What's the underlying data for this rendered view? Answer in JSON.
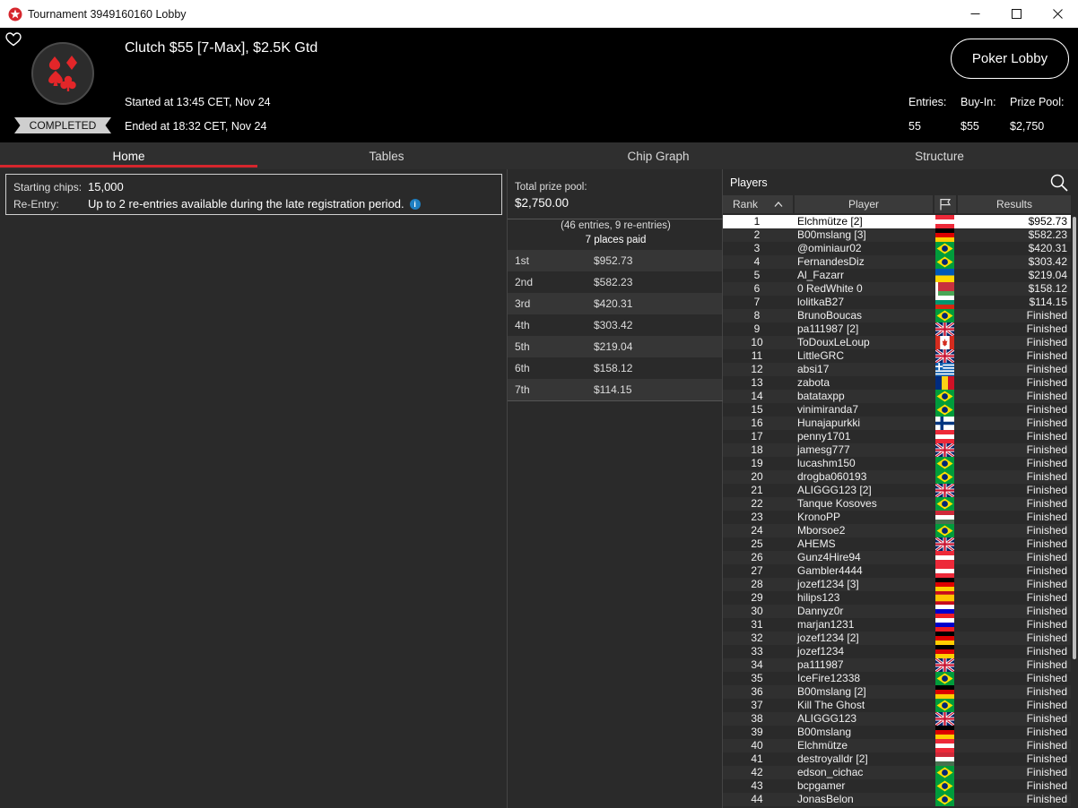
{
  "window": {
    "title": "Tournament 3949160160 Lobby",
    "controls": {
      "minimize": "minimize",
      "maximize": "maximize",
      "close": "close"
    }
  },
  "header": {
    "tournament_name": "Clutch $55 [7-Max], $2.5K Gtd",
    "started": "Started at 13:45 CET, Nov 24",
    "ended": "Ended at 18:32 CET, Nov 24",
    "status": "COMPLETED",
    "poker_lobby_label": "Poker Lobby",
    "entries_label": "Entries:",
    "entries_value": "55",
    "buyin_label": "Buy-In:",
    "buyin_value": "$55",
    "prizepool_label": "Prize Pool:",
    "prizepool_value": "$2,750",
    "icons": {
      "favorite": "heart-icon",
      "logo": "card-suits-logo"
    }
  },
  "tabs": [
    "Home",
    "Tables",
    "Chip Graph",
    "Structure"
  ],
  "active_tab": "Home",
  "home": {
    "starting_chips_label": "Starting chips:",
    "starting_chips_value": "15,000",
    "reentry_label": "Re-Entry:",
    "reentry_value": "Up to 2 re-entries available during the late registration period."
  },
  "prizes": {
    "total_label": "Total prize pool:",
    "total_value": "$2,750.00",
    "entries_note": "(46 entries, 9 re-entries)",
    "places_paid": "7 places paid",
    "payouts": [
      {
        "place": "1st",
        "amount": "$952.73"
      },
      {
        "place": "2nd",
        "amount": "$582.23"
      },
      {
        "place": "3rd",
        "amount": "$420.31"
      },
      {
        "place": "4th",
        "amount": "$303.42"
      },
      {
        "place": "5th",
        "amount": "$219.04"
      },
      {
        "place": "6th",
        "amount": "$158.12"
      },
      {
        "place": "7th",
        "amount": "$114.15"
      }
    ]
  },
  "players": {
    "title": "Players",
    "columns": {
      "rank": "Rank",
      "player": "Player",
      "results": "Results"
    },
    "colors": {
      "accent_red": "#d6262d",
      "row_alt": "#303030",
      "selected_row": "#ffffff"
    },
    "rows": [
      {
        "rank": "1",
        "name": "Elchmütze [2]",
        "flag": "austria",
        "result": "$952.73"
      },
      {
        "rank": "2",
        "name": "B00mslang [3]",
        "flag": "germany",
        "result": "$582.23"
      },
      {
        "rank": "3",
        "name": "@ominiaur02",
        "flag": "brazil",
        "result": "$420.31"
      },
      {
        "rank": "4",
        "name": "FernandesDiz",
        "flag": "brazil",
        "result": "$303.42"
      },
      {
        "rank": "5",
        "name": "Al_Fazarr",
        "flag": "ukraine",
        "result": "$219.04"
      },
      {
        "rank": "6",
        "name": "0 RedWhite 0",
        "flag": "belarus",
        "result": "$158.12"
      },
      {
        "rank": "7",
        "name": "lolitkaB27",
        "flag": "bulgaria",
        "result": "$114.15"
      },
      {
        "rank": "8",
        "name": "BrunoBoucas",
        "flag": "brazil",
        "result": "Finished"
      },
      {
        "rank": "9",
        "name": "pa111987 [2]",
        "flag": "uk",
        "result": "Finished"
      },
      {
        "rank": "10",
        "name": "ToDouxLeLoup",
        "flag": "canada",
        "result": "Finished"
      },
      {
        "rank": "11",
        "name": "LittleGRC",
        "flag": "uk",
        "result": "Finished"
      },
      {
        "rank": "12",
        "name": "absi17",
        "flag": "greece",
        "result": "Finished"
      },
      {
        "rank": "13",
        "name": "zabota",
        "flag": "romania",
        "result": "Finished"
      },
      {
        "rank": "14",
        "name": "batataxpp",
        "flag": "brazil",
        "result": "Finished"
      },
      {
        "rank": "15",
        "name": "vinimiranda7",
        "flag": "brazil",
        "result": "Finished"
      },
      {
        "rank": "16",
        "name": "Hunajapurkki",
        "flag": "finland",
        "result": "Finished"
      },
      {
        "rank": "17",
        "name": "penny1701",
        "flag": "austria",
        "result": "Finished"
      },
      {
        "rank": "18",
        "name": "jamesg777",
        "flag": "uk",
        "result": "Finished"
      },
      {
        "rank": "19",
        "name": "lucashm150",
        "flag": "brazil",
        "result": "Finished"
      },
      {
        "rank": "20",
        "name": "drogba060193",
        "flag": "brazil",
        "result": "Finished"
      },
      {
        "rank": "21",
        "name": "ALIGGG123 [2]",
        "flag": "uk",
        "result": "Finished"
      },
      {
        "rank": "22",
        "name": "Tanque Kosoves",
        "flag": "brazil",
        "result": "Finished"
      },
      {
        "rank": "23",
        "name": "KronoPP",
        "flag": "hungary",
        "result": "Finished"
      },
      {
        "rank": "24",
        "name": "Mborsoe2",
        "flag": "brazil",
        "result": "Finished"
      },
      {
        "rank": "25",
        "name": "AHEMS",
        "flag": "uk",
        "result": "Finished"
      },
      {
        "rank": "26",
        "name": "Gunz4Hire94",
        "flag": "austria",
        "result": "Finished"
      },
      {
        "rank": "27",
        "name": "Gambler4444",
        "flag": "austria",
        "result": "Finished"
      },
      {
        "rank": "28",
        "name": "jozef1234 [3]",
        "flag": "germany",
        "result": "Finished"
      },
      {
        "rank": "29",
        "name": "hilips123",
        "flag": "spain",
        "result": "Finished"
      },
      {
        "rank": "30",
        "name": "Dannyz0r",
        "flag": "slovenia",
        "result": "Finished"
      },
      {
        "rank": "31",
        "name": "marjan1231",
        "flag": "slovenia",
        "result": "Finished"
      },
      {
        "rank": "32",
        "name": "jozef1234 [2]",
        "flag": "germany",
        "result": "Finished"
      },
      {
        "rank": "33",
        "name": "jozef1234",
        "flag": "germany",
        "result": "Finished"
      },
      {
        "rank": "34",
        "name": "pa111987",
        "flag": "uk",
        "result": "Finished"
      },
      {
        "rank": "35",
        "name": "IceFire12338",
        "flag": "brazil",
        "result": "Finished"
      },
      {
        "rank": "36",
        "name": "B00mslang [2]",
        "flag": "germany",
        "result": "Finished"
      },
      {
        "rank": "37",
        "name": "Kill The Ghost",
        "flag": "brazil",
        "result": "Finished"
      },
      {
        "rank": "38",
        "name": "ALIGGG123",
        "flag": "uk",
        "result": "Finished"
      },
      {
        "rank": "39",
        "name": "B00mslang",
        "flag": "germany",
        "result": "Finished"
      },
      {
        "rank": "40",
        "name": "Elchmütze",
        "flag": "austria",
        "result": "Finished"
      },
      {
        "rank": "41",
        "name": "destroyalldr [2]",
        "flag": "hungary",
        "result": "Finished"
      },
      {
        "rank": "42",
        "name": "edson_cichac",
        "flag": "brazil",
        "result": "Finished"
      },
      {
        "rank": "43",
        "name": "bcpgamer",
        "flag": "brazil",
        "result": "Finished"
      },
      {
        "rank": "44",
        "name": "JonasBelon",
        "flag": "brazil",
        "result": "Finished"
      }
    ]
  }
}
